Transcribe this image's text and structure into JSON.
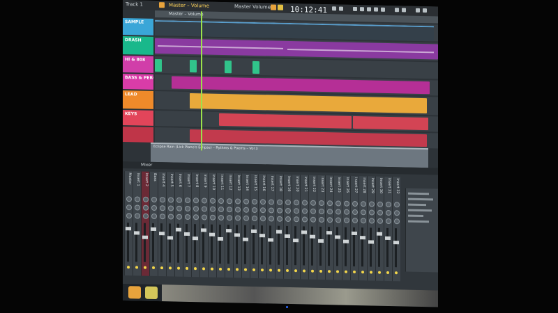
{
  "app": {
    "clock": "10:12:41",
    "topbar_labels": [
      "Track 1",
      "Master – Volume",
      "Master",
      "Volume"
    ]
  },
  "playlist": {
    "ruler_title": "Master – Volume",
    "tracks": [
      {
        "name": "SAMPLE",
        "color": "#3aa6d8"
      },
      {
        "name": "DRASH",
        "color": "#19b88b"
      },
      {
        "name": "HI & 808",
        "color": "#d13ea9"
      },
      {
        "name": "BASS & PERC",
        "color": "#d93ca8"
      },
      {
        "name": "LEAD",
        "color": "#ef8a2a"
      },
      {
        "name": "KEYS",
        "color": "#e2455a"
      },
      {
        "name": "",
        "color": "#bf3548"
      }
    ],
    "automation_label": "Eclipse Rain (Lick Piano's Eclipse) – Rythms & Poems – Vol 3"
  },
  "mixer": {
    "title": "Mixer",
    "strips": [
      "Master",
      "Insert 1",
      "Insert 2",
      "Bass",
      "Insert 4",
      "Insert 5",
      "Insert 6",
      "Insert 7",
      "Insert 8",
      "Insert 9",
      "Insert 10",
      "Insert 11",
      "Insert 12",
      "Insert 13",
      "Insert 14",
      "Insert 15",
      "Insert 16",
      "Insert 17",
      "Insert 18",
      "Insert 19",
      "Insert 20",
      "Insert 21",
      "Insert 22",
      "Insert 23",
      "Insert 24",
      "Insert 25",
      "Insert 26",
      "Insert 27",
      "Insert 28",
      "Insert 29",
      "Insert 30",
      "Insert 31",
      "Insert 32"
    ]
  },
  "colors": {
    "accent_orange": "#f0a437",
    "playhead_green": "#9be24b",
    "meter_yellow": "#f3d64a"
  }
}
